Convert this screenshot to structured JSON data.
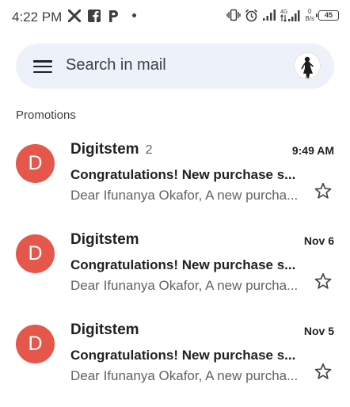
{
  "status_bar": {
    "time": "4:22 PM",
    "left_icons": [
      "x-icon",
      "facebook-icon",
      "pinterest-icon",
      "dot"
    ],
    "right_icons": [
      "vibrate-icon",
      "alarm-icon",
      "signal-icon",
      "4g-signal-icon"
    ],
    "net_speed_value": "0",
    "net_speed_unit": "B/s",
    "battery": "45"
  },
  "search": {
    "placeholder": "Search in mail"
  },
  "section_label": "Promotions",
  "mails": [
    {
      "avatar_letter": "D",
      "sender": "Digitstem",
      "count": "2",
      "time": "9:49 AM",
      "subject": "Congratulations! New purchase s...",
      "snippet": "Dear Ifunanya Okafor, A new purcha..."
    },
    {
      "avatar_letter": "D",
      "sender": "Digitstem",
      "count": "",
      "time": "Nov 6",
      "subject": "Congratulations! New purchase s...",
      "snippet": "Dear Ifunanya Okafor, A new purcha..."
    },
    {
      "avatar_letter": "D",
      "sender": "Digitstem",
      "count": "",
      "time": "Nov 5",
      "subject": "Congratulations! New purchase s...",
      "snippet": "Dear Ifunanya Okafor, A new purcha..."
    }
  ],
  "colors": {
    "avatar_bg": "#e4574a",
    "search_bg": "#edf2fa"
  }
}
